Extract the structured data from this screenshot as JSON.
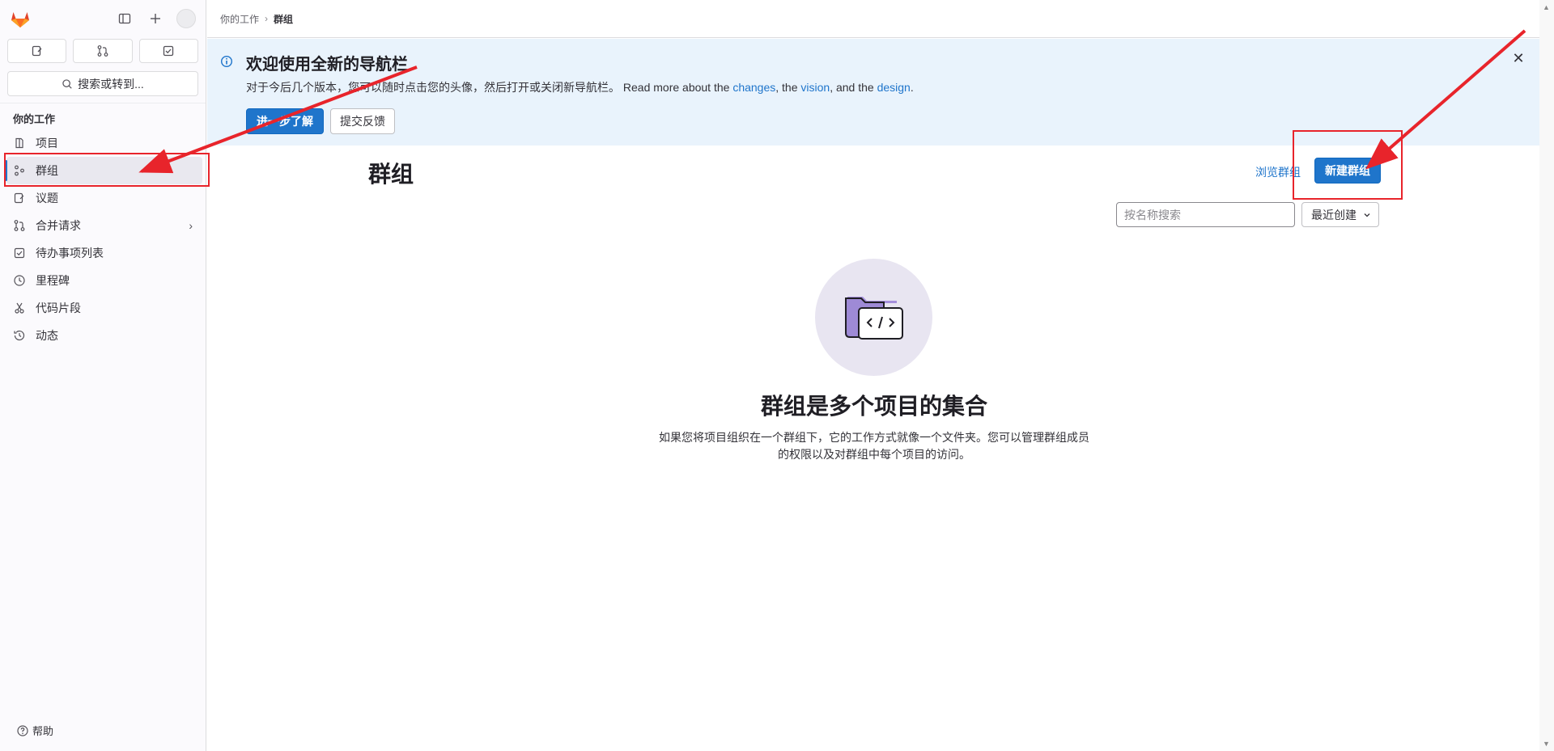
{
  "colors": {
    "accent": "#1f75cb",
    "banner_bg": "#e9f3fc",
    "annotation": "#e8242b"
  },
  "sidebar": {
    "search_label": "搜索或转到...",
    "section_title": "你的工作",
    "items": [
      {
        "label": "项目",
        "icon": "project-icon"
      },
      {
        "label": "群组",
        "icon": "group-icon"
      },
      {
        "label": "议题",
        "icon": "issues-icon"
      },
      {
        "label": "合并请求",
        "icon": "merge-request-icon"
      },
      {
        "label": "待办事项列表",
        "icon": "todo-icon"
      },
      {
        "label": "里程碑",
        "icon": "milestone-icon"
      },
      {
        "label": "代码片段",
        "icon": "snippet-icon"
      },
      {
        "label": "动态",
        "icon": "activity-icon"
      }
    ],
    "help_label": "帮助"
  },
  "breadcrumb": {
    "parent": "你的工作",
    "current": "群组"
  },
  "banner": {
    "title": "欢迎使用全新的导航栏",
    "text_prefix": "对于今后几个版本，您可以随时点击您的头像，然后打开或关闭新导航栏。 Read more about the ",
    "link_changes": "changes",
    "sep1": ", the ",
    "link_vision": "vision",
    "sep2": ", and the ",
    "link_design": "design",
    "suffix": ".",
    "learn_more": "进一步了解",
    "feedback": "提交反馈"
  },
  "main": {
    "title": "群组",
    "browse_groups": "浏览群组",
    "new_group": "新建群组",
    "search_placeholder": "按名称搜索",
    "sort_value": "最近创建"
  },
  "empty_state": {
    "title": "群组是多个项目的集合",
    "description": "如果您将项目组织在一个群组下，它的工作方式就像一个文件夹。您可以管理群组成员的权限以及对群组中每个项目的访问。"
  }
}
